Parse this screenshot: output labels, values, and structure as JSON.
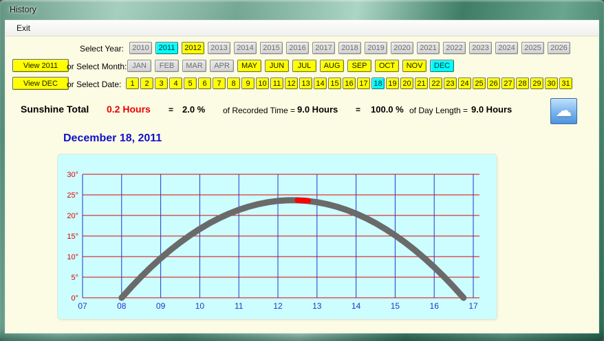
{
  "window": {
    "title": "History"
  },
  "menu": {
    "exit_label": "Exit"
  },
  "colors": {
    "selected_cyan": "#00ffff",
    "active_yellow": "#ffff00",
    "sunshine_red": "#e80000",
    "title_blue": "#1010cc",
    "panel_bg": "#ccfeff"
  },
  "year_selector": {
    "label": "Select Year:",
    "years": [
      {
        "label": "2010",
        "state": "gray"
      },
      {
        "label": "2011",
        "state": "cyan"
      },
      {
        "label": "2012",
        "state": "yellow"
      },
      {
        "label": "2013",
        "state": "gray"
      },
      {
        "label": "2014",
        "state": "gray"
      },
      {
        "label": "2015",
        "state": "gray"
      },
      {
        "label": "2016",
        "state": "gray"
      },
      {
        "label": "2017",
        "state": "gray"
      },
      {
        "label": "2018",
        "state": "gray"
      },
      {
        "label": "2019",
        "state": "gray"
      },
      {
        "label": "2020",
        "state": "gray"
      },
      {
        "label": "2021",
        "state": "gray"
      },
      {
        "label": "2022",
        "state": "gray"
      },
      {
        "label": "2023",
        "state": "gray"
      },
      {
        "label": "2024",
        "state": "gray"
      },
      {
        "label": "2025",
        "state": "gray"
      },
      {
        "label": "2026",
        "state": "gray"
      }
    ]
  },
  "month_selector": {
    "view_label": "View 2011",
    "label": "or Select Month:",
    "months": [
      {
        "label": "JAN",
        "state": "gray"
      },
      {
        "label": "FEB",
        "state": "gray"
      },
      {
        "label": "MAR",
        "state": "gray"
      },
      {
        "label": "APR",
        "state": "gray"
      },
      {
        "label": "MAY",
        "state": "yellow"
      },
      {
        "label": "JUN",
        "state": "yellow"
      },
      {
        "label": "JUL",
        "state": "yellow"
      },
      {
        "label": "AUG",
        "state": "yellow"
      },
      {
        "label": "SEP",
        "state": "yellow"
      },
      {
        "label": "OCT",
        "state": "yellow"
      },
      {
        "label": "NOV",
        "state": "yellow"
      },
      {
        "label": "DEC",
        "state": "cyan"
      }
    ]
  },
  "date_selector": {
    "view_label": "View DEC",
    "label": "or Select Date:",
    "dates": [
      {
        "label": "1",
        "state": "yellow"
      },
      {
        "label": "2",
        "state": "yellow"
      },
      {
        "label": "3",
        "state": "yellow"
      },
      {
        "label": "4",
        "state": "yellow"
      },
      {
        "label": "5",
        "state": "yellow"
      },
      {
        "label": "6",
        "state": "yellow"
      },
      {
        "label": "7",
        "state": "yellow"
      },
      {
        "label": "8",
        "state": "yellow"
      },
      {
        "label": "9",
        "state": "yellow"
      },
      {
        "label": "10",
        "state": "yellow"
      },
      {
        "label": "11",
        "state": "yellow"
      },
      {
        "label": "12",
        "state": "yellow"
      },
      {
        "label": "13",
        "state": "yellow"
      },
      {
        "label": "14",
        "state": "yellow"
      },
      {
        "label": "15",
        "state": "yellow"
      },
      {
        "label": "16",
        "state": "yellow"
      },
      {
        "label": "17",
        "state": "yellow"
      },
      {
        "label": "18",
        "state": "cyan"
      },
      {
        "label": "19",
        "state": "yellow"
      },
      {
        "label": "20",
        "state": "yellow"
      },
      {
        "label": "21",
        "state": "yellow"
      },
      {
        "label": "22",
        "state": "yellow"
      },
      {
        "label": "23",
        "state": "yellow"
      },
      {
        "label": "24",
        "state": "yellow"
      },
      {
        "label": "25",
        "state": "yellow"
      },
      {
        "label": "26",
        "state": "yellow"
      },
      {
        "label": "27",
        "state": "yellow"
      },
      {
        "label": "28",
        "state": "yellow"
      },
      {
        "label": "29",
        "state": "yellow"
      },
      {
        "label": "30",
        "state": "yellow"
      },
      {
        "label": "31",
        "state": "yellow"
      }
    ]
  },
  "summary": {
    "label": "Sunshine Total",
    "hours": "0.2 Hours",
    "eq1": "=",
    "pct_recorded": "2.0 %",
    "of_recorded": "of Recorded Time =",
    "recorded_hours": "9.0 Hours",
    "eq2": "=",
    "pct_day": "100.0 %",
    "of_day": "of Day Length =",
    "day_hours": "9.0 Hours",
    "cloud_icon_glyph": "☁"
  },
  "chart_data": {
    "type": "line",
    "title": "December 18, 2011",
    "xlim": [
      7,
      17
    ],
    "ylim": [
      0,
      30
    ],
    "x_tick_values": [
      7,
      8,
      9,
      10,
      11,
      12,
      13,
      14,
      15,
      16,
      17
    ],
    "x_tick_labels": [
      "07",
      "08",
      "09",
      "10",
      "11",
      "12",
      "13",
      "14",
      "15",
      "16",
      "17"
    ],
    "y_tick_values": [
      0,
      5,
      10,
      15,
      20,
      25,
      30
    ],
    "y_tick_labels": [
      "0°",
      "5°",
      "10°",
      "15°",
      "20°",
      "25°",
      "30°"
    ],
    "grid": {
      "vertical_color": "#2233cc",
      "horizontal_color": "#e00000",
      "on": true
    },
    "plot_bg": "#ccfeff",
    "legend": "none",
    "series": [
      {
        "name": "sun-elevation-curve",
        "color": "#6a6a6a",
        "width": 9,
        "points": [
          [
            8.0,
            0
          ],
          [
            8.25,
            2.63
          ],
          [
            8.5,
            5.11
          ],
          [
            8.75,
            7.43
          ],
          [
            9.0,
            9.6
          ],
          [
            9.25,
            11.61
          ],
          [
            9.5,
            13.47
          ],
          [
            9.75,
            15.17
          ],
          [
            10.0,
            16.72
          ],
          [
            10.25,
            18.11
          ],
          [
            10.5,
            19.35
          ],
          [
            10.75,
            20.43
          ],
          [
            11.0,
            21.36
          ],
          [
            11.25,
            22.13
          ],
          [
            11.5,
            22.75
          ],
          [
            11.75,
            23.22
          ],
          [
            12.0,
            23.53
          ],
          [
            12.25,
            23.68
          ],
          [
            12.5,
            23.68
          ],
          [
            12.75,
            23.53
          ],
          [
            13.0,
            23.22
          ],
          [
            13.25,
            22.75
          ],
          [
            13.5,
            22.13
          ],
          [
            13.75,
            21.36
          ],
          [
            14.0,
            20.43
          ],
          [
            14.25,
            19.35
          ],
          [
            14.5,
            18.11
          ],
          [
            14.75,
            16.72
          ],
          [
            15.0,
            15.17
          ],
          [
            15.25,
            13.47
          ],
          [
            15.5,
            11.61
          ],
          [
            15.75,
            9.6
          ],
          [
            16.0,
            7.43
          ],
          [
            16.25,
            5.11
          ],
          [
            16.5,
            2.63
          ],
          [
            16.75,
            0
          ]
        ]
      },
      {
        "name": "recorded-sunshine-segment",
        "color": "#ff0000",
        "width": 8,
        "points": [
          [
            12.5,
            23.68
          ],
          [
            12.78,
            23.55
          ]
        ]
      }
    ]
  }
}
